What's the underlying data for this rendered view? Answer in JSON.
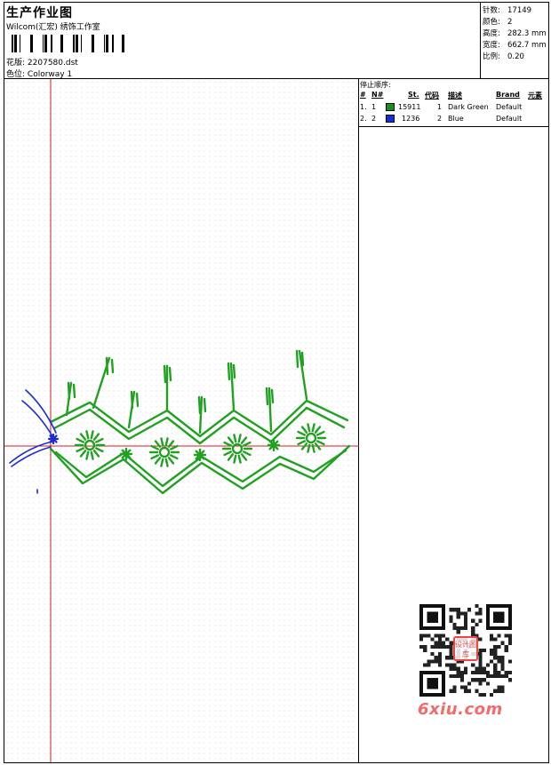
{
  "header": {
    "title": "生产作业图",
    "studio": "Wilcom(汇宏) 绣饰工作室",
    "design_label": "花版:",
    "design_value": "2207580.dst",
    "colorway_label": "色位:",
    "colorway_value": "Colorway 1"
  },
  "stats": [
    {
      "label": "针数:",
      "value": "17149"
    },
    {
      "label": "颜色:",
      "value": "2"
    },
    {
      "label": "高度:",
      "value": "282.3 mm"
    },
    {
      "label": "宽度:",
      "value": "662.7 mm"
    },
    {
      "label": "比例:",
      "value": "0.20"
    }
  ],
  "stop_sequence": {
    "caption": "停止顺序:",
    "headers": {
      "num": "#",
      "needle": "N#",
      "stitches": "St.",
      "code": "代码",
      "desc": "描述",
      "brand": "Brand",
      "element": "元素"
    },
    "rows": [
      {
        "num": "1.",
        "needle": "1",
        "color": "#1a8f1a",
        "stitches": "15911",
        "code": "1",
        "desc": "Dark Green",
        "brand": "Default"
      },
      {
        "num": "2.",
        "needle": "2",
        "color": "#1030e0",
        "stitches": "1236",
        "code": "2",
        "desc": "Blue",
        "brand": "Default"
      }
    ]
  },
  "design_colors": {
    "green": "#22a022",
    "blue": "#1a2ad8",
    "axis": "#d02020"
  },
  "watermark": {
    "text": "6xiu.com",
    "stamp": "设计图库"
  }
}
